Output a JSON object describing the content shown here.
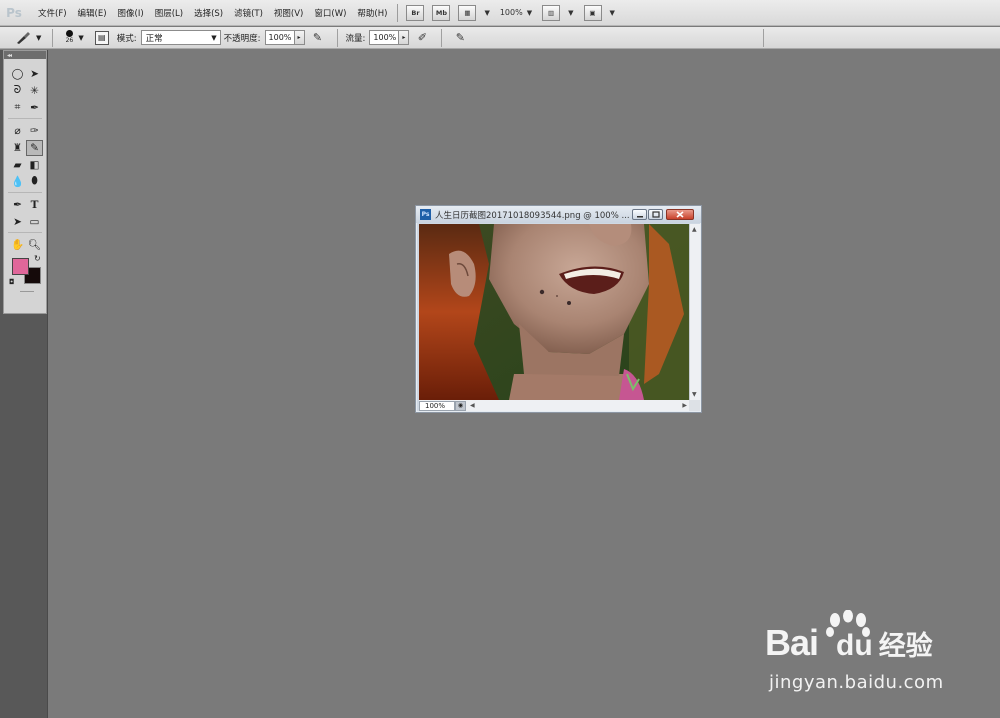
{
  "app": {
    "logo": "Ps"
  },
  "menubar": {
    "items": [
      "文件(F)",
      "编辑(E)",
      "图像(I)",
      "图层(L)",
      "选择(S)",
      "滤镜(T)",
      "视图(V)",
      "窗口(W)",
      "帮助(H)"
    ],
    "bridge_label": "Br",
    "minibridge_label": "Mb",
    "zoom": "100%"
  },
  "options": {
    "brush_size": "26",
    "mode_label": "模式:",
    "mode_value": "正常",
    "opacity_label": "不透明度:",
    "opacity_value": "100%",
    "flow_label": "流量:",
    "flow_value": "100%"
  },
  "colors": {
    "foreground": "#e0679a",
    "background": "#150a0a",
    "workspace": "#7a7a7a"
  },
  "tools": [
    [
      "marquee-icon",
      "move-icon"
    ],
    [
      "lasso-icon",
      "magic-wand-icon"
    ],
    [
      "crop-icon",
      "eyedropper-icon"
    ],
    [
      "healing-brush-icon",
      "brush-icon"
    ],
    [
      "clone-stamp-icon",
      "history-brush-icon"
    ],
    [
      "eraser-icon",
      "gradient-icon"
    ],
    [
      "blur-icon",
      "dodge-icon"
    ],
    [
      "pen-icon",
      "type-icon"
    ],
    [
      "path-selection-icon",
      "shape-icon"
    ],
    [
      "hand-icon",
      "zoom-icon"
    ]
  ],
  "document": {
    "title": "人生日历截图20171018093544.png @ 100% ...",
    "zoom": "100%"
  },
  "watermark": {
    "brand": "Bai",
    "brand_du": "du",
    "brand_suffix": "经验",
    "url": "jingyan.baidu.com"
  }
}
